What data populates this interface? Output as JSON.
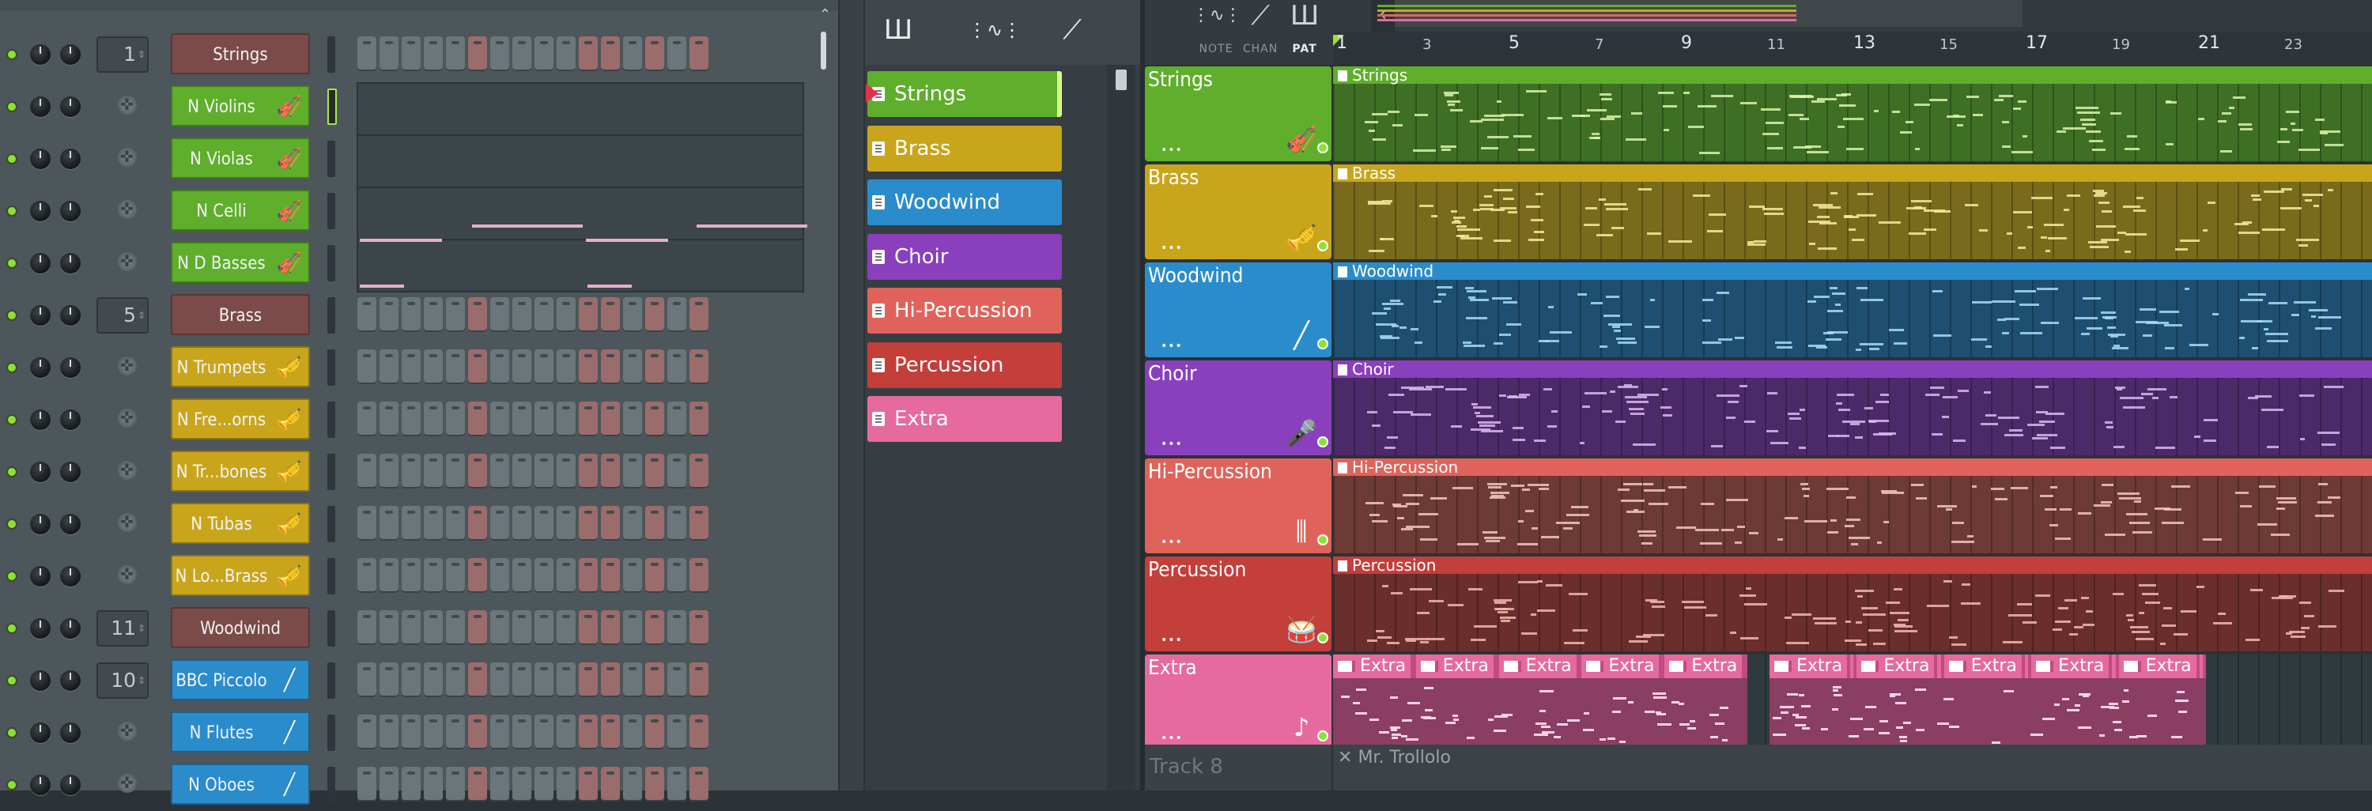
{
  "channel_rack": {
    "rows": [
      {
        "kind": "header",
        "route": "1",
        "label": "Strings",
        "color": "#7a4b48"
      },
      {
        "kind": "channel",
        "label": "N Violins",
        "color": "green",
        "icon": "violin-icon",
        "glyph": "🎻",
        "selected": true
      },
      {
        "kind": "channel",
        "label": "N Violas",
        "color": "green",
        "icon": "violin-icon",
        "glyph": "🎻"
      },
      {
        "kind": "channel",
        "label": "N Celli",
        "color": "green",
        "icon": "violin-icon",
        "glyph": "🎻"
      },
      {
        "kind": "channel",
        "label": "N D Basses",
        "color": "green",
        "icon": "violin-icon",
        "glyph": "🎻"
      },
      {
        "kind": "header",
        "route": "5",
        "label": "Brass",
        "color": "#7a4b48"
      },
      {
        "kind": "channel",
        "label": "N Trumpets",
        "color": "gold",
        "icon": "trumpet-icon",
        "glyph": "🎺"
      },
      {
        "kind": "channel",
        "label": "N Fre...orns",
        "color": "gold",
        "icon": "trumpet-icon",
        "glyph": "🎺"
      },
      {
        "kind": "channel",
        "label": "N Tr...bones",
        "color": "gold",
        "icon": "trumpet-icon",
        "glyph": "🎺"
      },
      {
        "kind": "channel",
        "label": "N Tubas",
        "color": "gold",
        "icon": "trumpet-icon",
        "glyph": "🎺"
      },
      {
        "kind": "channel",
        "label": "N Lo...Brass",
        "color": "gold",
        "icon": "trumpet-icon",
        "glyph": "🎺"
      },
      {
        "kind": "header",
        "route": "11",
        "label": "Woodwind",
        "color": "#7a4b48"
      },
      {
        "kind": "channel",
        "route": "10",
        "label": "BBC Piccolo",
        "color": "blue",
        "icon": "flute-icon",
        "glyph": "╱"
      },
      {
        "kind": "channel",
        "label": "N Flutes",
        "color": "blue",
        "icon": "flute-icon",
        "glyph": "╱"
      },
      {
        "kind": "channel",
        "label": "N Oboes",
        "color": "blue",
        "icon": "flute-icon",
        "glyph": "╱"
      }
    ]
  },
  "patterns": {
    "toolbar": [
      {
        "name": "piano-roll-icon",
        "glyph": "Ш"
      },
      {
        "name": "waveform-icon",
        "glyph": "⋮∿⋮"
      },
      {
        "name": "automation-icon",
        "glyph": "⟋"
      }
    ],
    "items": [
      {
        "label": "Strings",
        "color": "#5fae2c",
        "selected": true
      },
      {
        "label": "Brass",
        "color": "#c9a51c"
      },
      {
        "label": "Woodwind",
        "color": "#2b8ccc"
      },
      {
        "label": "Choir",
        "color": "#8a3fbd"
      },
      {
        "label": "Hi-Percussion",
        "color": "#e0635b"
      },
      {
        "label": "Percussion",
        "color": "#c43e3a"
      },
      {
        "label": "Extra",
        "color": "#e66a9e"
      }
    ]
  },
  "playlist": {
    "header": {
      "labels": {
        "note": "NOTE",
        "chan": "CHAN",
        "pat": "PAT"
      },
      "scroll_left": "‹"
    },
    "ruler": [
      {
        "n": "1",
        "big": true
      },
      {
        "n": "3"
      },
      {
        "n": "5",
        "big": true
      },
      {
        "n": "7"
      },
      {
        "n": "9",
        "big": true
      },
      {
        "n": "11"
      },
      {
        "n": "13",
        "big": true
      },
      {
        "n": "15"
      },
      {
        "n": "17",
        "big": true
      },
      {
        "n": "19"
      },
      {
        "n": "21",
        "big": true
      },
      {
        "n": "23"
      }
    ],
    "tracks": [
      {
        "name": "Strings",
        "color": "#5fae2c",
        "lane": "#3f6f24",
        "clip": "Strings",
        "icon": "violin-icon",
        "glyph": "🎻",
        "note": "#d9f5a8"
      },
      {
        "name": "Brass",
        "color": "#c9a51c",
        "lane": "#7a6a1c",
        "clip": "Brass",
        "icon": "trumpet-icon",
        "glyph": "🎺",
        "note": "#f6ea9e"
      },
      {
        "name": "Woodwind",
        "color": "#2b8ccc",
        "lane": "#1e4f70",
        "clip": "Woodwind",
        "icon": "flute-icon",
        "glyph": "╱",
        "note": "#a5dcf5"
      },
      {
        "name": "Choir",
        "color": "#8a3fbd",
        "lane": "#4c2a6a",
        "clip": "Choir",
        "icon": "microphone-icon",
        "glyph": "🎤",
        "note": "#dcb6f2"
      },
      {
        "name": "Hi-Percussion",
        "color": "#e0635b",
        "lane": "#6e3a36",
        "clip": "Hi-Percussion",
        "icon": "xylophone-icon",
        "glyph": "⫼",
        "note": "#f5c6c0"
      },
      {
        "name": "Percussion",
        "color": "#c43e3a",
        "lane": "#6a2e2c",
        "clip": "Percussion",
        "icon": "drum-icon",
        "glyph": "🥁",
        "note": "#f1b8b2"
      },
      {
        "name": "Extra",
        "color": "#e66a9e",
        "lane": "#7a3a58",
        "clip": "Extra",
        "icon": "notes-icon",
        "glyph": "♪",
        "note": "#ffd2e6"
      }
    ],
    "extra_clip_label": "Extra",
    "track8": {
      "name": "Track 8",
      "clip": "Mr. Trollolo"
    }
  }
}
